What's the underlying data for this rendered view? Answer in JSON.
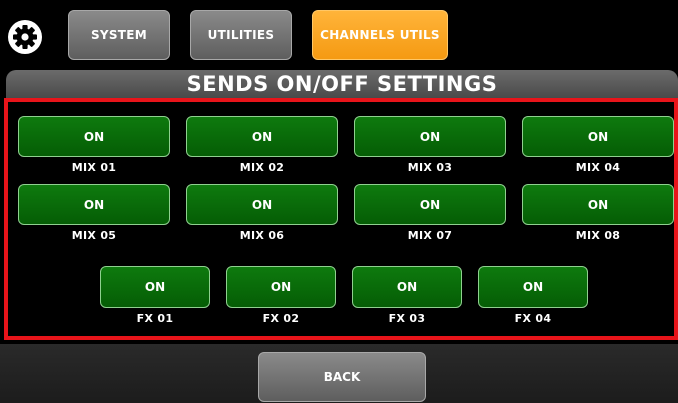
{
  "tabs": [
    {
      "label": "SYSTEM"
    },
    {
      "label": "UTILITIES"
    },
    {
      "label": "CHANNELS UTILS"
    }
  ],
  "title": "SENDS ON/OFF SETTINGS",
  "mix_sends": [
    {
      "state": "ON",
      "label": "MIX 01"
    },
    {
      "state": "ON",
      "label": "MIX 02"
    },
    {
      "state": "ON",
      "label": "MIX 03"
    },
    {
      "state": "ON",
      "label": "MIX 04"
    },
    {
      "state": "ON",
      "label": "MIX 05"
    },
    {
      "state": "ON",
      "label": "MIX 06"
    },
    {
      "state": "ON",
      "label": "MIX 07"
    },
    {
      "state": "ON",
      "label": "MIX 08"
    }
  ],
  "fx_sends": [
    {
      "state": "ON",
      "label": "FX 01"
    },
    {
      "state": "ON",
      "label": "FX 02"
    },
    {
      "state": "ON",
      "label": "FX 03"
    },
    {
      "state": "ON",
      "label": "FX 04"
    }
  ],
  "back_label": "BACK",
  "colors": {
    "active_tab": "#f59a12",
    "send_on": "#0e7a0e",
    "frame": "#e8141a"
  },
  "icons": {
    "settings": "gear-icon"
  }
}
